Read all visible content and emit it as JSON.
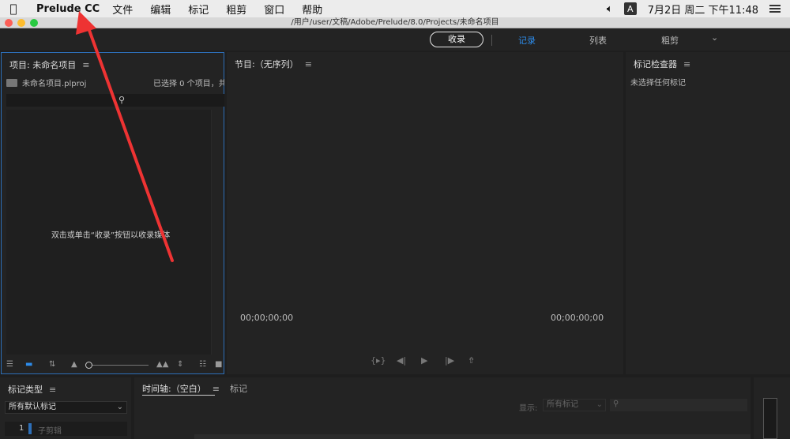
{
  "menubar": {
    "app_name": "Prelude CC",
    "items": [
      "文件",
      "编辑",
      "标记",
      "粗剪",
      "窗口",
      "帮助"
    ],
    "ime": "A",
    "clock": "7月2日 周二 下午11:48"
  },
  "window": {
    "title": "/用户/user/文稿/Adobe/Prelude/8.0/Projects/未命名项目"
  },
  "workspace": {
    "ingest_label": "收录",
    "tabs": [
      "记录",
      "列表",
      "粗剪"
    ],
    "active_tab": "记录"
  },
  "project_panel": {
    "title": "项目: 未命名项目",
    "file_name": "未命名项目.plproj",
    "selection_info": "已选择 0 个项目，共",
    "empty_hint": "双击或单击“收录”按钮以收录媒体"
  },
  "program_panel": {
    "title": "节目:（无序列）",
    "timecode_left": "00;00;00;00",
    "timecode_right": "00;00;00;00"
  },
  "inspector_panel": {
    "title": "标记检查器",
    "empty_text": "未选择任何标记"
  },
  "marker_panel": {
    "title": "标记类型",
    "selected_set": "所有默认标记",
    "items": [
      {
        "number": "1",
        "label": "子剪辑",
        "color": "#2d6fb8"
      }
    ]
  },
  "timeline_panel": {
    "title": "时间轴:（空白）",
    "tab2": "标记",
    "show_label": "显示:",
    "show_value": "所有标记"
  },
  "colors": {
    "accent": "#2d8ceb",
    "annotation_arrow": "#ee3333"
  }
}
